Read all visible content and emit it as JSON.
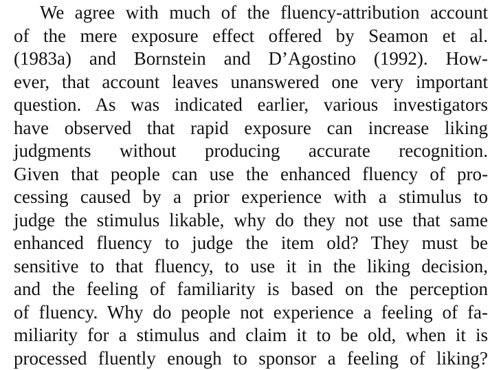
{
  "paragraph": {
    "lines": [
      "We agree with much of the fluency-attribution account",
      "of the mere exposure effect offered by Seamon et al.",
      "(1983a) and Bornstein and D’Agostino (1992). How-",
      "ever, that account leaves unanswered one very important",
      "question. As was indicated earlier, various investigators",
      "have observed that rapid exposure can increase liking",
      "judgments without producing accurate recognition.",
      "Given that people can use the enhanced fluency of pro-",
      "cessing caused by a prior experience with a stimulus to",
      "judge the stimulus likable, why do they not use that same",
      "enhanced fluency to judge the item old? They must be",
      "sensitive to that fluency, to use it in the liking decision,",
      "and the feeling of familiarity is based on the perception",
      "of fluency. Why do people not experience a feeling of fa-",
      "miliarity for a stimulus and claim it to be old, when it is",
      "processed fluently enough to sponsor a feeling of liking?"
    ]
  }
}
